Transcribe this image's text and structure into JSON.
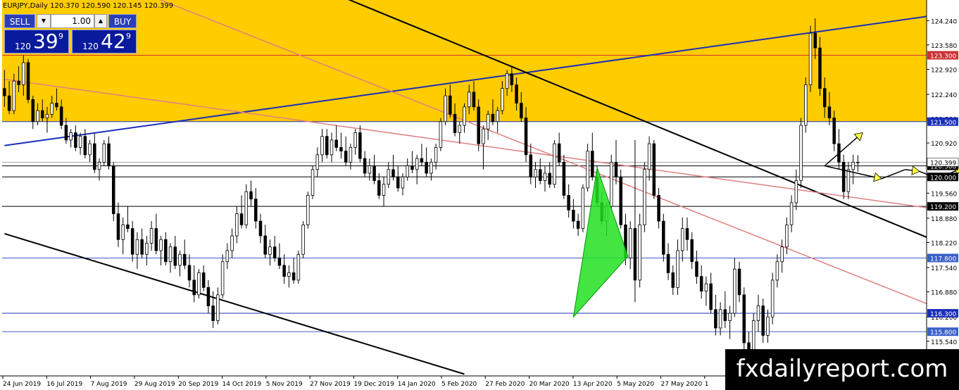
{
  "header": {
    "title": "EURJPY,Daily  120.370 120.590 120.145 120.399"
  },
  "trade_panel": {
    "sell_label": "SELL",
    "buy_label": "BUY",
    "lot": "1.00",
    "sell_prefix": "120",
    "sell_big": "39",
    "sell_sup": "9",
    "buy_prefix": "120",
    "buy_big": "42",
    "buy_sup": "9",
    "down_arrow": "▼",
    "up_arrow": "▲"
  },
  "watermark": "fxdailyreport.com",
  "chart_data": {
    "type": "candlestick",
    "symbol": "EURJPY",
    "timeframe": "Daily",
    "ylim": [
      114.6,
      124.8
    ],
    "y_ticks": [
      124.24,
      123.58,
      122.92,
      122.24,
      121.58,
      120.92,
      120.3,
      119.56,
      118.88,
      118.22,
      117.54,
      116.88,
      116.2,
      115.54
    ],
    "y_tick_labels": [
      "124.240",
      "123.580",
      "122.920",
      "122.240",
      "121.580",
      "120.920",
      "120.300",
      "119.560",
      "118.880",
      "118.220",
      "117.540",
      "116.880",
      "116.200",
      "115.540"
    ],
    "x_tick_labels": [
      "24 Jun 2019",
      "16 Jul 2019",
      "7 Aug 2019",
      "29 Aug 2019",
      "20 Sep 2019",
      "14 Oct 2019",
      "5 Nov 2019",
      "27 Nov 2019",
      "19 Dec 2019",
      "14 Jan 2020",
      "5 Feb 2020",
      "27 Feb 2020",
      "20 Mar 2020",
      "13 Apr 2020",
      "5 May 2020",
      "27 May 2020",
      "1"
    ],
    "price_levels": [
      {
        "price": 123.3,
        "label": "123.300",
        "color": "#cc3333"
      },
      {
        "price": 121.5,
        "label": "121.500",
        "color": "#1a2fb8"
      },
      {
        "price": 120.3,
        "label": "120.300",
        "color": "#000000"
      },
      {
        "price": 120.0,
        "label": "120.000",
        "color": "#000000"
      },
      {
        "price": 119.2,
        "label": "119.200",
        "color": "#000000"
      },
      {
        "price": 117.8,
        "label": "117.800",
        "color": "#3a60c8"
      },
      {
        "price": 116.3,
        "label": "116.300",
        "color": "#1a2fb8"
      },
      {
        "price": 115.8,
        "label": "115.800",
        "color": "#3a60c8"
      }
    ],
    "current_price_label": "120.399",
    "supply_zone": [
      121.5,
      124.8
    ],
    "candles": [
      [
        122.4,
        122.9,
        121.9,
        122.2
      ],
      [
        122.2,
        122.6,
        121.7,
        121.8
      ],
      [
        121.8,
        122.8,
        121.7,
        122.6
      ],
      [
        122.6,
        123.0,
        122.3,
        122.5
      ],
      [
        122.5,
        123.3,
        122.2,
        123.1
      ],
      [
        123.1,
        123.2,
        122.0,
        122.1
      ],
      [
        122.1,
        122.2,
        121.3,
        121.5
      ],
      [
        121.5,
        122.0,
        121.4,
        121.8
      ],
      [
        121.8,
        122.1,
        121.5,
        121.6
      ],
      [
        121.6,
        121.9,
        121.2,
        121.7
      ],
      [
        121.7,
        122.2,
        121.6,
        122.0
      ],
      [
        122.0,
        122.4,
        121.8,
        121.9
      ],
      [
        121.9,
        122.1,
        121.3,
        121.4
      ],
      [
        121.4,
        121.6,
        120.9,
        121.0
      ],
      [
        121.0,
        121.3,
        120.8,
        121.2
      ],
      [
        121.2,
        121.4,
        120.7,
        120.8
      ],
      [
        120.8,
        121.2,
        120.6,
        121.1
      ],
      [
        121.1,
        121.3,
        120.5,
        120.6
      ],
      [
        120.6,
        121.0,
        120.4,
        120.9
      ],
      [
        120.9,
        121.2,
        120.1,
        120.2
      ],
      [
        120.2,
        120.5,
        119.9,
        120.4
      ],
      [
        120.4,
        121.0,
        120.3,
        120.9
      ],
      [
        120.9,
        121.1,
        120.2,
        120.3
      ],
      [
        120.3,
        120.4,
        118.8,
        119.0
      ],
      [
        119.0,
        119.3,
        118.1,
        118.3
      ],
      [
        118.3,
        118.9,
        117.9,
        118.7
      ],
      [
        118.7,
        119.2,
        118.5,
        118.6
      ],
      [
        118.6,
        118.8,
        117.7,
        117.9
      ],
      [
        117.9,
        118.5,
        117.5,
        118.3
      ],
      [
        118.3,
        118.6,
        117.8,
        117.9
      ],
      [
        117.9,
        118.4,
        117.6,
        118.2
      ],
      [
        118.2,
        118.8,
        118.0,
        118.6
      ],
      [
        118.6,
        119.0,
        117.9,
        118.0
      ],
      [
        118.0,
        118.4,
        117.6,
        118.3
      ],
      [
        118.3,
        118.5,
        117.6,
        117.7
      ],
      [
        117.7,
        118.2,
        117.4,
        118.1
      ],
      [
        118.1,
        118.4,
        117.5,
        117.6
      ],
      [
        117.6,
        118.0,
        117.3,
        117.9
      ],
      [
        117.9,
        118.3,
        117.5,
        117.6
      ],
      [
        117.6,
        117.9,
        117.0,
        117.2
      ],
      [
        117.2,
        117.6,
        116.6,
        116.8
      ],
      [
        116.8,
        117.5,
        116.7,
        117.4
      ],
      [
        117.4,
        117.6,
        116.9,
        117.0
      ],
      [
        117.0,
        117.2,
        116.3,
        116.5
      ],
      [
        116.5,
        116.9,
        115.9,
        116.1
      ],
      [
        116.1,
        117.0,
        116.0,
        116.8
      ],
      [
        116.8,
        117.9,
        116.7,
        117.7
      ],
      [
        117.7,
        118.2,
        117.5,
        118.0
      ],
      [
        118.0,
        118.6,
        117.8,
        118.4
      ],
      [
        118.4,
        119.2,
        118.2,
        119.0
      ],
      [
        119.0,
        119.5,
        118.6,
        118.7
      ],
      [
        118.7,
        119.8,
        118.6,
        119.6
      ],
      [
        119.6,
        119.9,
        119.2,
        119.4
      ],
      [
        119.4,
        119.7,
        118.6,
        118.8
      ],
      [
        118.8,
        119.0,
        118.2,
        118.4
      ],
      [
        118.4,
        118.7,
        117.8,
        117.9
      ],
      [
        117.9,
        118.3,
        117.6,
        118.1
      ],
      [
        118.1,
        118.4,
        117.7,
        117.8
      ],
      [
        117.8,
        118.2,
        117.5,
        117.6
      ],
      [
        117.6,
        117.9,
        117.1,
        117.3
      ],
      [
        117.3,
        117.6,
        117.0,
        117.4
      ],
      [
        117.4,
        117.8,
        117.1,
        117.2
      ],
      [
        117.2,
        118.0,
        117.1,
        117.9
      ],
      [
        117.9,
        118.8,
        117.8,
        118.7
      ],
      [
        118.7,
        119.6,
        118.6,
        119.5
      ],
      [
        119.5,
        120.3,
        119.4,
        120.2
      ],
      [
        120.2,
        120.8,
        120.0,
        120.6
      ],
      [
        120.6,
        121.3,
        120.4,
        121.1
      ],
      [
        121.1,
        121.3,
        120.5,
        120.6
      ],
      [
        120.6,
        121.2,
        120.4,
        121.0
      ],
      [
        121.0,
        121.4,
        120.7,
        120.8
      ],
      [
        120.8,
        121.2,
        120.5,
        120.7
      ],
      [
        120.7,
        121.1,
        120.3,
        120.4
      ],
      [
        120.4,
        120.9,
        120.2,
        120.8
      ],
      [
        120.8,
        121.3,
        120.6,
        121.2
      ],
      [
        121.2,
        121.4,
        120.4,
        120.5
      ],
      [
        120.5,
        120.7,
        120.0,
        120.1
      ],
      [
        120.1,
        120.5,
        119.9,
        120.3
      ],
      [
        120.3,
        120.6,
        119.8,
        119.9
      ],
      [
        119.9,
        120.1,
        119.4,
        119.5
      ],
      [
        119.5,
        120.0,
        119.2,
        119.8
      ],
      [
        119.8,
        120.4,
        119.7,
        120.2
      ],
      [
        120.2,
        120.6,
        119.9,
        120.0
      ],
      [
        120.0,
        120.3,
        119.6,
        119.7
      ],
      [
        119.7,
        120.1,
        119.5,
        120.0
      ],
      [
        120.0,
        120.5,
        119.9,
        120.3
      ],
      [
        120.3,
        120.7,
        120.1,
        120.2
      ],
      [
        120.2,
        120.6,
        119.8,
        120.5
      ],
      [
        120.5,
        120.9,
        120.3,
        120.4
      ],
      [
        120.4,
        120.8,
        120.0,
        120.1
      ],
      [
        120.1,
        120.5,
        119.9,
        120.4
      ],
      [
        120.4,
        120.9,
        120.2,
        120.8
      ],
      [
        120.8,
        121.6,
        120.7,
        121.5
      ],
      [
        121.5,
        122.4,
        121.4,
        122.2
      ],
      [
        122.2,
        122.5,
        121.6,
        121.7
      ],
      [
        121.7,
        122.0,
        121.1,
        121.2
      ],
      [
        121.2,
        121.5,
        120.9,
        121.4
      ],
      [
        121.4,
        122.0,
        121.2,
        121.9
      ],
      [
        121.9,
        122.5,
        121.7,
        122.3
      ],
      [
        122.3,
        122.6,
        121.8,
        121.9
      ],
      [
        121.9,
        122.1,
        120.7,
        120.9
      ],
      [
        120.9,
        121.4,
        120.2,
        121.3
      ],
      [
        121.3,
        121.8,
        121.0,
        121.7
      ],
      [
        121.7,
        122.1,
        121.4,
        121.5
      ],
      [
        121.5,
        121.9,
        121.2,
        121.8
      ],
      [
        121.8,
        122.6,
        121.7,
        122.4
      ],
      [
        122.4,
        122.9,
        122.2,
        122.8
      ],
      [
        122.8,
        123.0,
        122.3,
        122.5
      ],
      [
        122.5,
        122.7,
        121.8,
        122.0
      ],
      [
        122.0,
        122.3,
        121.5,
        121.6
      ],
      [
        121.6,
        121.9,
        120.4,
        120.6
      ],
      [
        120.6,
        120.9,
        119.8,
        120.0
      ],
      [
        120.0,
        120.4,
        119.7,
        120.2
      ],
      [
        120.2,
        120.5,
        119.8,
        119.9
      ],
      [
        119.9,
        120.3,
        119.6,
        120.1
      ],
      [
        120.1,
        120.4,
        119.7,
        119.8
      ],
      [
        119.8,
        121.0,
        119.7,
        120.9
      ],
      [
        120.9,
        121.2,
        120.3,
        120.4
      ],
      [
        120.4,
        120.6,
        119.4,
        119.5
      ],
      [
        119.5,
        119.8,
        118.9,
        119.1
      ],
      [
        119.1,
        119.4,
        118.6,
        118.8
      ],
      [
        118.8,
        119.0,
        118.4,
        118.6
      ],
      [
        118.6,
        119.8,
        118.5,
        119.7
      ],
      [
        119.7,
        120.9,
        119.6,
        120.7
      ],
      [
        120.7,
        121.2,
        119.9,
        120.0
      ],
      [
        120.0,
        120.3,
        119.2,
        119.3
      ],
      [
        119.3,
        119.6,
        118.7,
        118.8
      ],
      [
        118.8,
        119.3,
        118.4,
        119.2
      ],
      [
        119.2,
        120.6,
        119.1,
        120.4
      ],
      [
        120.4,
        121.0,
        119.8,
        120.0
      ],
      [
        120.0,
        120.2,
        118.6,
        118.7
      ],
      [
        118.7,
        119.0,
        117.6,
        117.8
      ],
      [
        117.8,
        118.8,
        117.5,
        118.6
      ],
      [
        118.6,
        121.0,
        116.6,
        117.2
      ],
      [
        117.2,
        119.0,
        117.0,
        118.7
      ],
      [
        118.7,
        120.4,
        118.5,
        120.2
      ],
      [
        120.2,
        121.1,
        119.9,
        120.9
      ],
      [
        120.9,
        121.0,
        119.4,
        119.5
      ],
      [
        119.5,
        119.7,
        118.6,
        118.8
      ],
      [
        118.8,
        119.0,
        117.7,
        117.9
      ],
      [
        117.9,
        118.2,
        117.2,
        117.4
      ],
      [
        117.4,
        117.6,
        116.8,
        117.0
      ],
      [
        117.0,
        118.3,
        116.8,
        118.0
      ],
      [
        118.0,
        118.9,
        117.7,
        118.6
      ],
      [
        118.6,
        118.9,
        118.0,
        118.3
      ],
      [
        118.3,
        118.5,
        117.5,
        117.7
      ],
      [
        117.7,
        118.0,
        117.1,
        117.3
      ],
      [
        117.3,
        117.6,
        116.7,
        116.9
      ],
      [
        116.9,
        117.3,
        116.5,
        117.1
      ],
      [
        117.1,
        117.4,
        116.3,
        116.4
      ],
      [
        116.4,
        116.8,
        115.7,
        115.9
      ],
      [
        115.9,
        116.6,
        115.7,
        116.4
      ],
      [
        116.4,
        116.9,
        115.9,
        116.1
      ],
      [
        116.1,
        116.5,
        115.6,
        116.3
      ],
      [
        116.3,
        117.8,
        116.2,
        117.5
      ],
      [
        117.5,
        117.7,
        116.6,
        116.8
      ],
      [
        116.8,
        117.0,
        115.3,
        115.5
      ],
      [
        115.5,
        115.8,
        114.8,
        115.0
      ],
      [
        115.0,
        116.3,
        114.9,
        116.1
      ],
      [
        116.1,
        116.8,
        115.8,
        116.5
      ],
      [
        116.5,
        116.7,
        115.5,
        115.7
      ],
      [
        115.7,
        116.4,
        115.5,
        116.2
      ],
      [
        116.2,
        117.4,
        116.0,
        117.2
      ],
      [
        117.2,
        117.9,
        117.0,
        117.7
      ],
      [
        117.7,
        118.3,
        117.4,
        118.1
      ],
      [
        118.1,
        118.9,
        117.9,
        118.7
      ],
      [
        118.7,
        119.5,
        118.5,
        119.3
      ],
      [
        119.3,
        120.2,
        119.1,
        119.9
      ],
      [
        119.9,
        121.6,
        119.7,
        121.4
      ],
      [
        121.4,
        122.7,
        121.2,
        122.5
      ],
      [
        122.5,
        124.1,
        122.3,
        123.9
      ],
      [
        123.9,
        124.3,
        123.2,
        123.5
      ],
      [
        123.5,
        123.8,
        122.2,
        122.4
      ],
      [
        122.4,
        122.7,
        121.6,
        121.9
      ],
      [
        121.9,
        122.3,
        121.4,
        121.6
      ],
      [
        121.6,
        121.8,
        120.7,
        120.9
      ],
      [
        120.9,
        121.3,
        120.2,
        120.4
      ],
      [
        120.4,
        120.6,
        119.4,
        119.6
      ],
      [
        119.6,
        120.4,
        119.4,
        120.2
      ],
      [
        120.2,
        120.6,
        119.8,
        120.4
      ],
      [
        120.4,
        120.59,
        120.14,
        120.4
      ]
    ],
    "trendlines": [
      {
        "name": "rising-resistance",
        "color": "#1a2fb8",
        "p1": [
          0,
          120.85
        ],
        "p2": [
          211,
          124.65
        ]
      },
      {
        "name": "falling-upper",
        "color": "#000000",
        "p1": [
          70,
          124.95
        ],
        "p2": [
          211,
          117.49
        ]
      },
      {
        "name": "falling-lower",
        "color": "#000000",
        "p1": [
          0,
          118.46
        ],
        "p2": [
          97,
          114.65
        ]
      },
      {
        "name": "channel-upper",
        "color": "#e08080",
        "p1": [
          0,
          122.65
        ],
        "p2": [
          211,
          118.87
        ]
      },
      {
        "name": "channel-lower",
        "color": "#e08080",
        "p1": [
          30,
          124.95
        ],
        "p2": [
          211,
          115.72
        ]
      }
    ],
    "triangle": {
      "color": "#22e022",
      "points": [
        [
          125,
          120.25
        ],
        [
          131.5,
          117.85
        ],
        [
          120,
          116.2
        ]
      ]
    },
    "forecast_path": [
      [
        173,
        120.3
      ],
      [
        185,
        119.95
      ],
      [
        190,
        120.2
      ],
      [
        193,
        120.15
      ],
      [
        197,
        119.95
      ],
      [
        202,
        120.25
      ],
      [
        206,
        120.3
      ],
      [
        212,
        120.0
      ]
    ],
    "forecast_alt": [
      [
        173,
        120.3
      ],
      [
        181,
        121.2
      ]
    ]
  }
}
